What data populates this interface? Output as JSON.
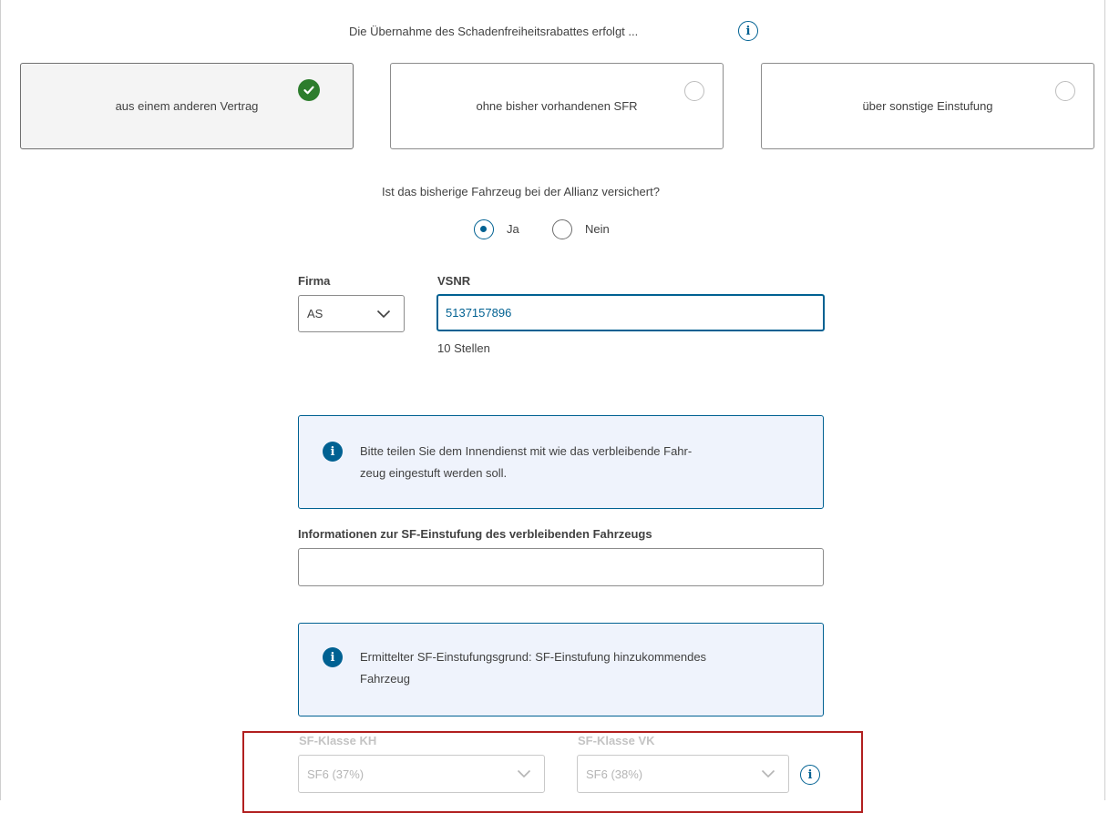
{
  "sfr_transfer": {
    "question": "Die Übernahme des Schadenfreiheitsrabattes erfolgt ...",
    "options": [
      {
        "label": "aus einem anderen Vertrag",
        "selected": true
      },
      {
        "label": "ohne bisher vorhandenen SFR",
        "selected": false
      },
      {
        "label": "über sonstige Einstufung",
        "selected": false
      }
    ]
  },
  "insured_question": {
    "text": "Ist das bisherige Fahrzeug bei der Allianz versichert?",
    "yes_label": "Ja",
    "no_label": "Nein",
    "selected": "Ja"
  },
  "firma": {
    "label": "Firma",
    "value": "AS"
  },
  "vsnr": {
    "label": "VSNR",
    "value": "5137157896",
    "hint": "10 Stellen"
  },
  "info_box_1": {
    "line1": "Bitte teilen Sie dem Innendienst mit wie das verbleibende Fahr-",
    "line2": "zeug eingestuft werden soll."
  },
  "sf_info_field": {
    "label": "Informationen zur SF-Einstufung des verbleibenden Fahrzeugs",
    "value": ""
  },
  "info_box_2": {
    "line1": "Ermittelter SF-Einstufungsgrund: SF-Einstufung hinzukommendes",
    "line2": "Fahrzeug"
  },
  "sf_klasse_kh": {
    "label": "SF-Klasse KH",
    "value": "SF6 (37%)"
  },
  "sf_klasse_vk": {
    "label": "SF-Klasse VK",
    "value": "SF6 (38%)"
  },
  "colors": {
    "primary": "#006192",
    "success": "#2d7d2d",
    "highlight": "#b11f1f",
    "info_bg": "#eff3fc"
  },
  "icons": [
    "info-icon",
    "check-icon",
    "chevron-down-icon"
  ]
}
